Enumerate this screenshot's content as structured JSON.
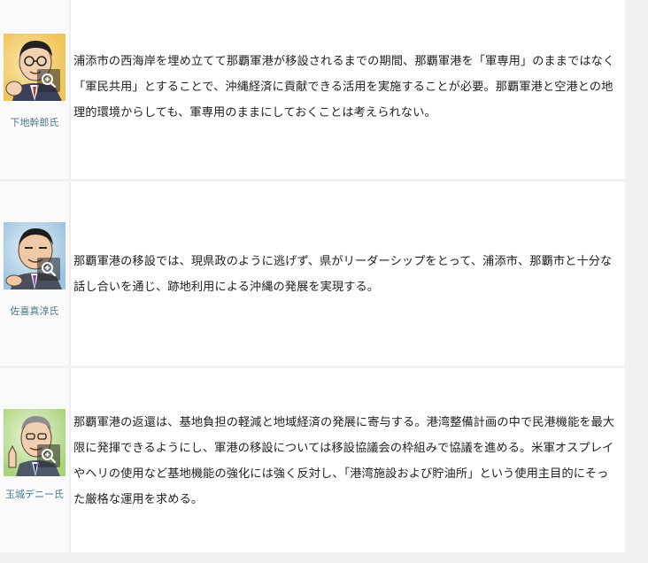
{
  "rows": [
    {
      "name": "下地幹郎氏",
      "comment": "浦添市の西海岸を埋め立てて那覇軍港が移設されるまでの期間、那覇軍港を「軍専用」のままではなく「軍民共用」とすることで、沖縄経済に貢献できる活用を実施することが必要。那覇軍港と空港との地理的環境からしても、軍専用のままにしておくことは考えられない。",
      "avatar_icon": "caricature-portrait-icon",
      "bg_color": "#f4d27a"
    },
    {
      "name": "佐喜真淳氏",
      "comment": "那覇軍港の移設では、現県政のように逃げず、県がリーダーシップをとって、浦添市、那覇市と十分な話し合いを通じ、跡地利用による沖縄の発展を実現する。",
      "avatar_icon": "caricature-portrait-icon",
      "bg_color": "#a9cbe3"
    },
    {
      "name": "玉城デニー氏",
      "comment": "那覇軍港の返還は、基地負担の軽減と地域経済の発展に寄与する。港湾整備計画の中で民港機能を最大限に発揮できるようにし、軍港の移設については移設協議会の枠組みで協議を進める。米軍オスプレイやヘリの使用など基地機能の強化には強く反対し、「港湾施設および貯油所」という使用主目的にそった厳格な運用を求める。",
      "avatar_icon": "caricature-portrait-icon",
      "bg_color": "#b9dc8f"
    }
  ],
  "zoom_icon": "zoom-in-icon",
  "colors": {
    "name_text": "#4a7a8c",
    "body_text": "#222222",
    "page_bg": "#f1f1f1"
  }
}
